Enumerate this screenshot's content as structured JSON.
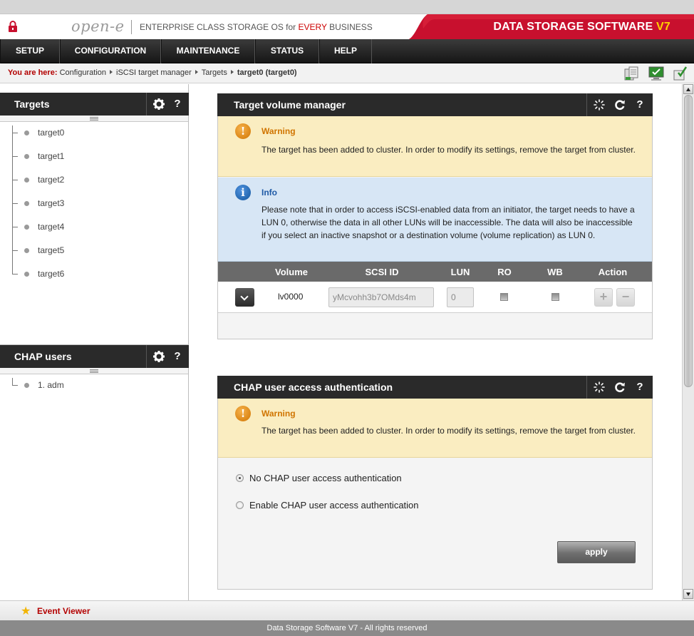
{
  "header": {
    "logo": "open-e",
    "tagline_pre": "ENTERPRISE CLASS STORAGE OS for ",
    "tagline_em": "EVERY",
    "tagline_post": " BUSINESS",
    "brand": "DATA STORAGE SOFTWARE ",
    "brand_version": "V7"
  },
  "nav": {
    "items": [
      {
        "label": "SETUP"
      },
      {
        "label": "CONFIGURATION"
      },
      {
        "label": "MAINTENANCE"
      },
      {
        "label": "STATUS"
      },
      {
        "label": "HELP"
      }
    ]
  },
  "breadcrumb": {
    "lead": "You are here:",
    "items": [
      "Configuration",
      "iSCSI target manager",
      "Targets"
    ],
    "current": "target0 (target0)"
  },
  "targets_pane": {
    "title": "Targets",
    "settings_icon": "gear-icon",
    "help": "?",
    "items": [
      "target0",
      "target1",
      "target2",
      "target3",
      "target4",
      "target5",
      "target6"
    ]
  },
  "chap_pane": {
    "title": "CHAP users",
    "help": "?",
    "items": [
      "1. adm"
    ]
  },
  "volume_panel": {
    "title": "Target volume manager",
    "help": "?",
    "warning_title": "Warning",
    "warning_text": "The target has been added to cluster. In order to modify its settings, remove the target from cluster.",
    "info_title": "Info",
    "info_text": "Please note that in order to access iSCSI-enabled data from an initiator, the target needs to have a LUN 0, otherwise the data in all other LUNs will be inaccessible. The data will also be inaccessible if you select an inactive snapshot or a destination volume (volume replication) as LUN 0.",
    "columns": [
      "Volume",
      "SCSI ID",
      "LUN",
      "RO",
      "WB",
      "Action"
    ],
    "rows": [
      {
        "volume": "lv0000",
        "scsi_id": "yMcvohh3b7OMds4m",
        "lun": "0",
        "ro": false,
        "wb": false
      }
    ],
    "action_add": "+",
    "action_remove": "−"
  },
  "chap_panel": {
    "title": "CHAP user access authentication",
    "help": "?",
    "warning_title": "Warning",
    "warning_text": "The target has been added to cluster. In order to modify its settings, remove the target from cluster.",
    "options": [
      {
        "label": "No CHAP user access authentication",
        "selected": true
      },
      {
        "label": "Enable CHAP user access authentication",
        "selected": false
      }
    ],
    "apply_label": "apply"
  },
  "event_viewer": {
    "label": "Event Viewer"
  },
  "footer": {
    "text": "Data Storage Software V7 - All rights reserved"
  },
  "colors": {
    "brand_red": "#c8102e",
    "warning_bg": "#faedc1",
    "info_bg": "#d7e6f5",
    "header_dark": "#2a2a2a"
  }
}
